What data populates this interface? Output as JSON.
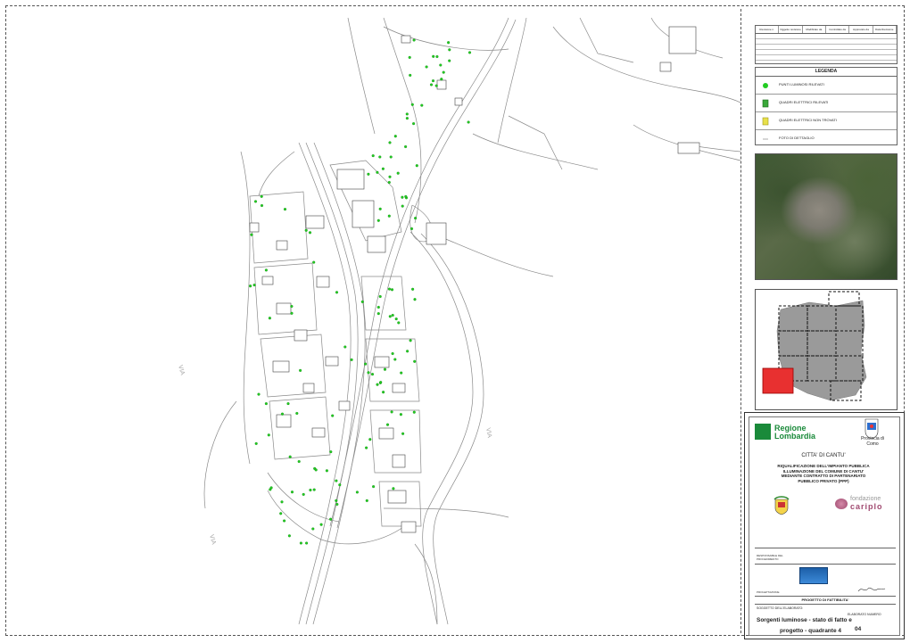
{
  "revision_table": {
    "headers": [
      "Revisione n.",
      "Oggetto revisione",
      "Modificato da",
      "Controllato da",
      "Approvato da",
      "Data Revisione"
    ]
  },
  "legend": {
    "title": "LEGENDA",
    "items": [
      {
        "label": "PUNTI LUMINOSI RILEVATI",
        "symbol": "green-dot-icon",
        "color": "#22cc22"
      },
      {
        "label": "QUADRI ELETTRICI RILEVATI",
        "symbol": "green-box-icon",
        "color": "#3aa83a"
      },
      {
        "label": "QUADRI ELETTRICI NON TROVATI",
        "symbol": "yellow-box-icon",
        "color": "#e8e04a"
      },
      {
        "label": "FOTO DI DETTAGLIO",
        "symbol": "photo-marker-icon",
        "color": "#777777"
      }
    ]
  },
  "title_block": {
    "region_line1": "Regione",
    "region_line2": "Lombardia",
    "province": "Provincia di Como",
    "city": "CITTA' DI CANTU'",
    "project_lines": [
      "RIQUALIFICAZIONE DELL'IMPIANTO PUBBLICA",
      "ILLUMINAZIONE DEL COMUNE DI CANTU'",
      "MEDIANTE CONTRATTO DI PARTENARIATO",
      "PUBBLICO PRIVATO (PPP)"
    ],
    "foundation_line1": "fondazione",
    "foundation_line2": "cariplo",
    "responsabile": "RESPONSABILE DEL PROCEDIMENTO",
    "progettazione": "PROGETTAZIONE",
    "fase": "PROGETTO DI FATTIBILITA'",
    "soggetto": "SOGGETTO DELL'ELABORATO:",
    "elaborato_label": "ELABORATO NUMERO",
    "drawing_title_line1": "Sorgenti luminose - stato di fatto e",
    "drawing_title_line2": "progetto - quadrante 4",
    "drawing_number": "04"
  },
  "colors": {
    "light_point": "#22cc22",
    "highlight_quadrant": "#e83030",
    "map_line": "#8a8a8a"
  }
}
